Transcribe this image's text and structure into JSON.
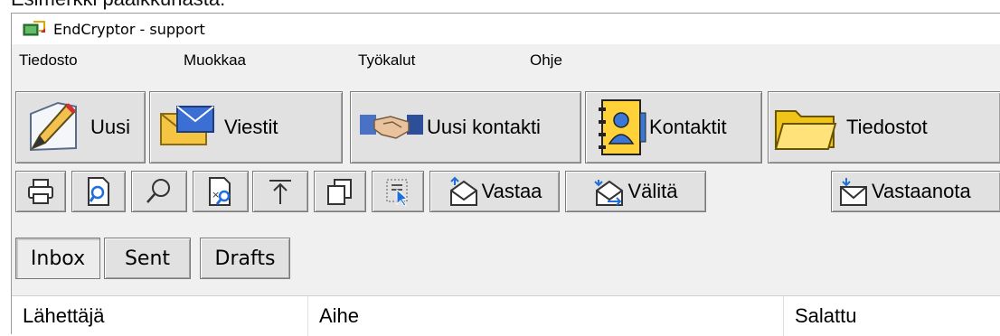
{
  "caption": "Esimerkki pääikkunasta:",
  "window": {
    "title": "EndCryptor - support"
  },
  "menu": [
    {
      "label": "Tiedosto"
    },
    {
      "label": "Muokkaa"
    },
    {
      "label": "Työkalut"
    },
    {
      "label": "Ohje"
    }
  ],
  "big_toolbar": [
    {
      "label": "Uusi",
      "icon": "pencil-icon"
    },
    {
      "label": "Viestit",
      "icon": "envelope-icon"
    },
    {
      "label": "Uusi kontakti",
      "icon": "handshake-icon"
    },
    {
      "label": "Kontaktit",
      "icon": "address-book-icon"
    },
    {
      "label": "Tiedostot",
      "icon": "folder-icon"
    }
  ],
  "small_toolbar": {
    "icons": [
      "printer-icon",
      "print-preview-icon",
      "search-icon",
      "find-in-attachment-icon",
      "move-up-icon",
      "copy-icon",
      "select-icon"
    ],
    "reply_label": "Vastaa",
    "forward_label": "Välitä",
    "receive_label": "Vastaanota"
  },
  "tabs": [
    {
      "label": "Inbox",
      "active": true
    },
    {
      "label": "Sent"
    },
    {
      "label": "Drafts"
    }
  ],
  "table": {
    "columns": [
      "Lähettäjä",
      "Aihe",
      "Salattu"
    ]
  }
}
